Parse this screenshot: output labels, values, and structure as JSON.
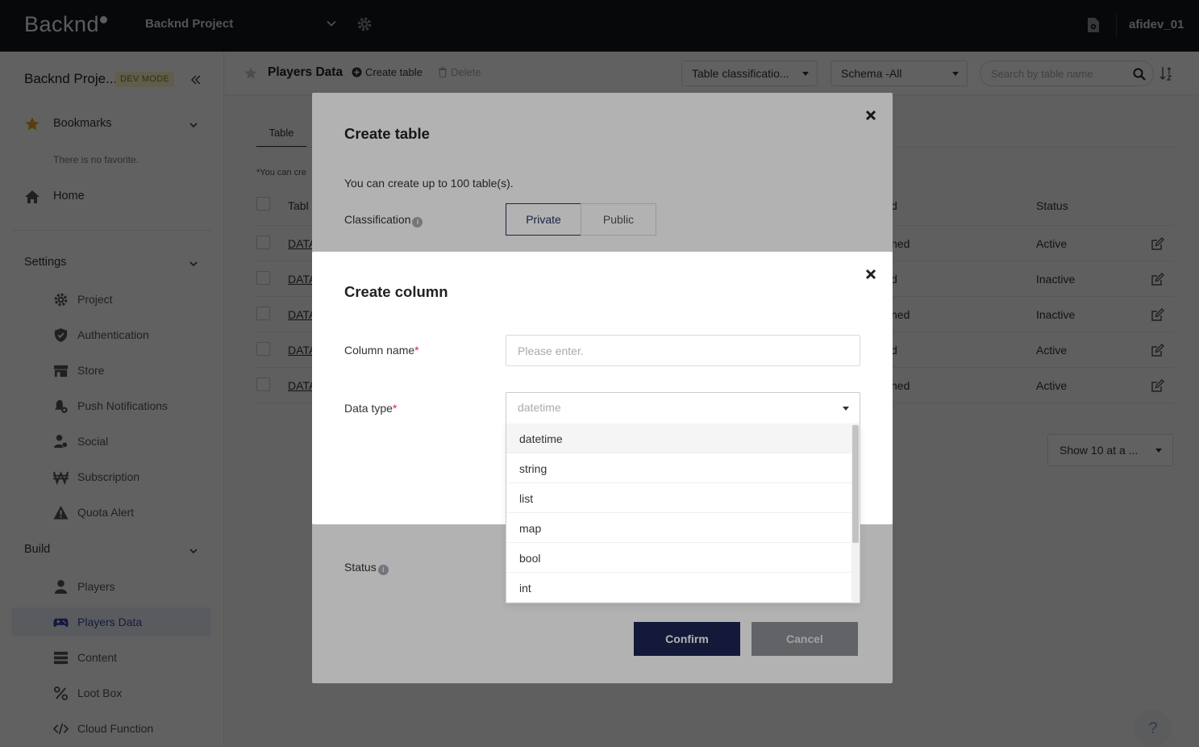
{
  "topbar": {
    "logo": "Backnd",
    "project_name": "Backnd Project",
    "username": "afidev_01"
  },
  "sidebar": {
    "project_title": "Backnd Proje...",
    "dev_badge": "DEV MODE",
    "bookmarks_label": "Bookmarks",
    "no_favorite": "There is no favorite.",
    "home_label": "Home",
    "settings_label": "Settings",
    "settings_items": [
      {
        "label": "Project",
        "icon": "gear-icon"
      },
      {
        "label": "Authentication",
        "icon": "shield-icon"
      },
      {
        "label": "Store",
        "icon": "store-icon"
      },
      {
        "label": "Push Notifications",
        "icon": "bell-icon"
      },
      {
        "label": "Social",
        "icon": "social-icon"
      },
      {
        "label": "Subscription",
        "icon": "won-icon"
      },
      {
        "label": "Quota Alert",
        "icon": "warning-icon"
      }
    ],
    "build_label": "Build",
    "build_items": [
      {
        "label": "Players",
        "icon": "user-icon"
      },
      {
        "label": "Players Data",
        "icon": "gamepad-icon"
      },
      {
        "label": "Content",
        "icon": "list-icon"
      },
      {
        "label": "Loot Box",
        "icon": "percent-icon"
      },
      {
        "label": "Cloud Function",
        "icon": "code-icon"
      }
    ],
    "accent_color": "#3a4aa5"
  },
  "header": {
    "page_title": "Players Data",
    "create_table_label": "Create table",
    "delete_label": "Delete",
    "classification_select": "Table classificatio...",
    "schema_select": "Schema -All",
    "search_placeholder": "Search by table name"
  },
  "table": {
    "tab_label": "Table",
    "note": "*You can cre",
    "col_name": "Tabl",
    "col_schema": "d",
    "col_status": "Status",
    "rows": [
      {
        "name": "DATA",
        "schema": "ned",
        "status": "Active"
      },
      {
        "name": "DATA",
        "schema": "d",
        "status": "Inactive"
      },
      {
        "name": "DATA",
        "schema": "ned",
        "status": "Inactive"
      },
      {
        "name": "DATA",
        "schema": "d",
        "status": "Active"
      },
      {
        "name": "DATA",
        "schema": "ned",
        "status": "Active"
      }
    ],
    "page_size_select": "Show 10 at a ..."
  },
  "help_label": "?",
  "create_table_modal": {
    "title": "Create table",
    "limit_text": "You can create up to 100 table(s).",
    "classification_label": "Classification",
    "option_private": "Private",
    "option_public": "Public",
    "status_label": "Status",
    "confirm_label": "Confirm",
    "cancel_label": "Cancel"
  },
  "create_column_modal": {
    "title": "Create column",
    "column_name_label": "Column name",
    "column_name_placeholder": "Please enter.",
    "data_type_label": "Data type",
    "required_mark": "*",
    "data_type_value": "datetime",
    "options": [
      "datetime",
      "string",
      "list",
      "map",
      "bool",
      "int"
    ]
  }
}
